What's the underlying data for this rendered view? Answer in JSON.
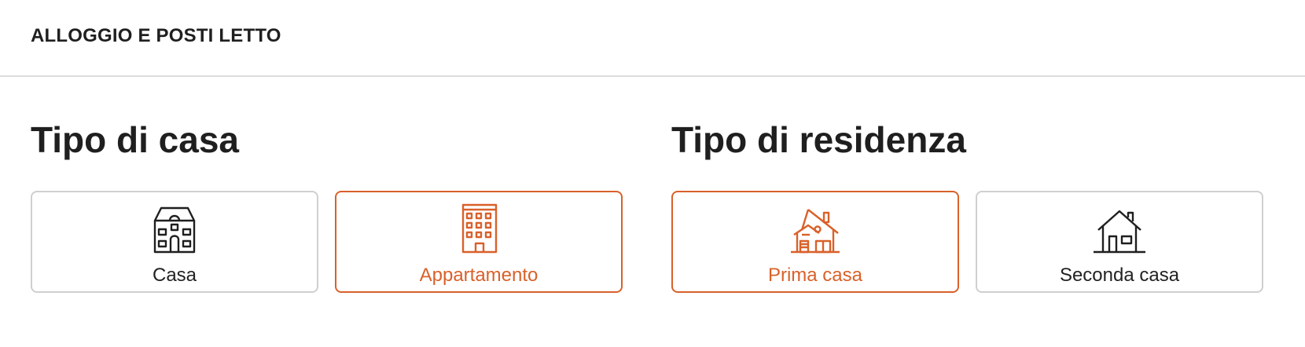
{
  "header": {
    "title": "ALLOGGIO E POSTI LETTO"
  },
  "house_type": {
    "title": "Tipo di casa",
    "options": [
      {
        "label": "Casa",
        "icon": "house-icon",
        "selected": false
      },
      {
        "label": "Appartamento",
        "icon": "apartment-building-icon",
        "selected": true
      }
    ]
  },
  "residence_type": {
    "title": "Tipo di residenza",
    "options": [
      {
        "label": "Prima casa",
        "icon": "primary-home-icon",
        "selected": true
      },
      {
        "label": "Seconda casa",
        "icon": "secondary-home-icon",
        "selected": false
      }
    ]
  },
  "colors": {
    "accent": "#d9612a",
    "border": "#cfcfcf",
    "text": "#1f1f1f"
  }
}
